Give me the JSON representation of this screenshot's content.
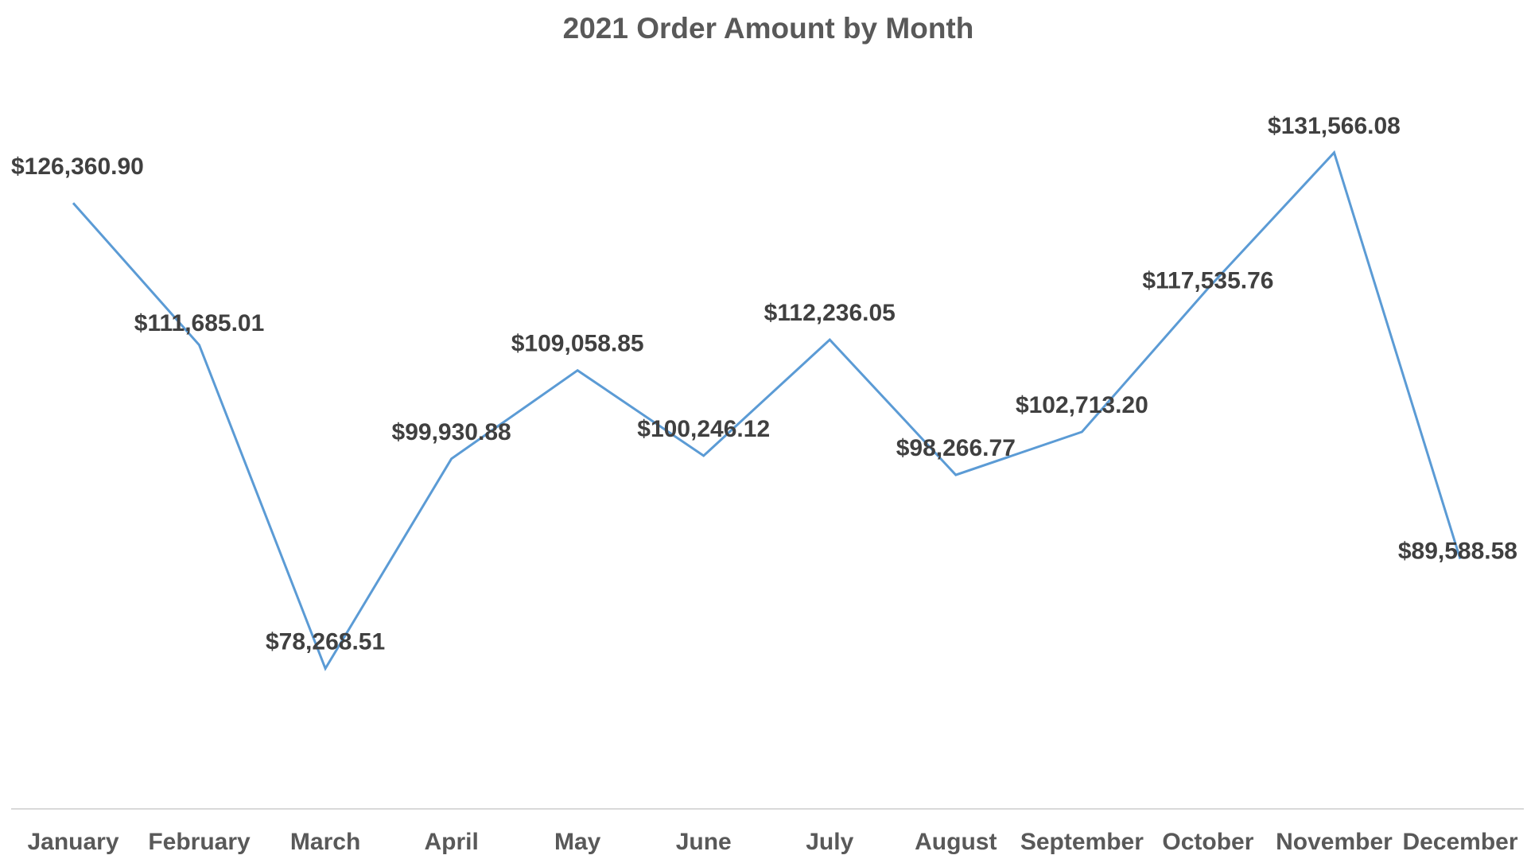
{
  "chart_data": {
    "type": "line",
    "title": "2021 Order Amount by Month",
    "xlabel": "",
    "ylabel": "",
    "categories": [
      "January",
      "February",
      "March",
      "April",
      "May",
      "June",
      "July",
      "August",
      "September",
      "October",
      "November",
      "December"
    ],
    "series": [
      {
        "values": [
          126360.9,
          111685.01,
          78268.51,
          99930.88,
          109058.85,
          100246.12,
          112236.05,
          98266.77,
          102713.2,
          117535.76,
          131566.08,
          89588.58
        ],
        "labels": [
          "$126,360.90",
          "$111,685.01",
          "$78,268.51",
          "$99,930.88",
          "$109,058.85",
          "$100,246.12",
          "$112,236.05",
          "$98,266.77",
          "$102,713.20",
          "$117,535.76",
          "$131,566.08",
          "$89,588.58"
        ],
        "color": "#5b9bd5"
      }
    ],
    "ylim": [
      65000,
      135000
    ],
    "grid": false,
    "legend": "none",
    "y_axis_visible": false
  }
}
